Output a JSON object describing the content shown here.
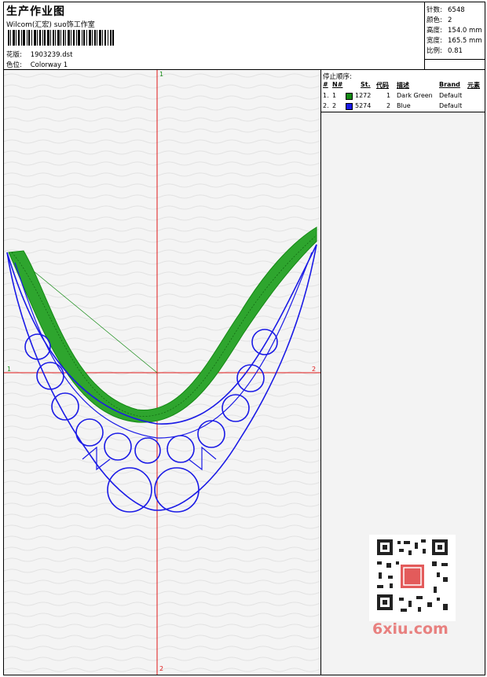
{
  "header": {
    "title": "生产作业图",
    "studio": "Wilcom(汇宏) suo饰工作室",
    "pattern_label": "花版:",
    "pattern_value": "1903239.dst",
    "colorway_label": "色位:",
    "colorway_value": "Colorway 1"
  },
  "stats": [
    {
      "label": "针数:",
      "value": "6548"
    },
    {
      "label": "颜色:",
      "value": "2"
    },
    {
      "label": "高度:",
      "value": "154.0 mm"
    },
    {
      "label": "宽度:",
      "value": "165.5 mm"
    },
    {
      "label": "比例:",
      "value": "0.81"
    }
  ],
  "stop_sequence": {
    "title": "停止顺序:",
    "columns": {
      "num": "#",
      "n": "N#",
      "st": "St.",
      "code": "代码",
      "desc": "描述",
      "brand": "Brand",
      "element": "元素"
    },
    "rows": [
      {
        "num": "1.",
        "n": "1",
        "color": "#138a13",
        "st": "1272",
        "code": "1",
        "desc": "Dark Green",
        "brand": "Default"
      },
      {
        "num": "2.",
        "n": "2",
        "color": "#1a1ae6",
        "st": "5274",
        "code": "2",
        "desc": "Blue",
        "brand": "Default"
      }
    ]
  },
  "axis_labels": {
    "top": "1",
    "bottom": "2",
    "left": "1",
    "right": "2"
  },
  "colors": {
    "thread_green": "#138a13",
    "thread_blue": "#1a1ae6",
    "axis_red": "#e01818"
  },
  "watermark": {
    "qr_icon": "qr-code-icon",
    "site": "6xiu.com"
  }
}
